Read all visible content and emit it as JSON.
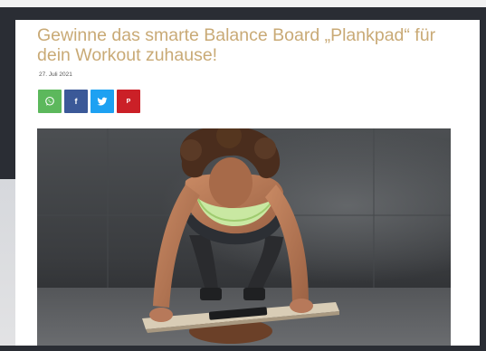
{
  "article": {
    "title": "Gewinne das smarte Balance Board „Plankpad“ für dein Workout zuhause!",
    "date": "27. Juli 2021"
  },
  "share_buttons": [
    {
      "network": "WhatsApp",
      "icon": "whatsapp-icon",
      "color": "#5cb85c"
    },
    {
      "network": "Facebook",
      "icon": "facebook-icon",
      "glyph": "f",
      "color": "#3b5998"
    },
    {
      "network": "Twitter",
      "icon": "twitter-icon",
      "color": "#1da1f2"
    },
    {
      "network": "Pinterest",
      "icon": "pinterest-icon",
      "glyph": "P",
      "color": "#cb2027"
    }
  ],
  "hero_image": {
    "subject": "woman doing a plank on a balance board in a concrete gym"
  },
  "colors": {
    "title": "#c9aa76",
    "frame": "#2a2d34"
  }
}
